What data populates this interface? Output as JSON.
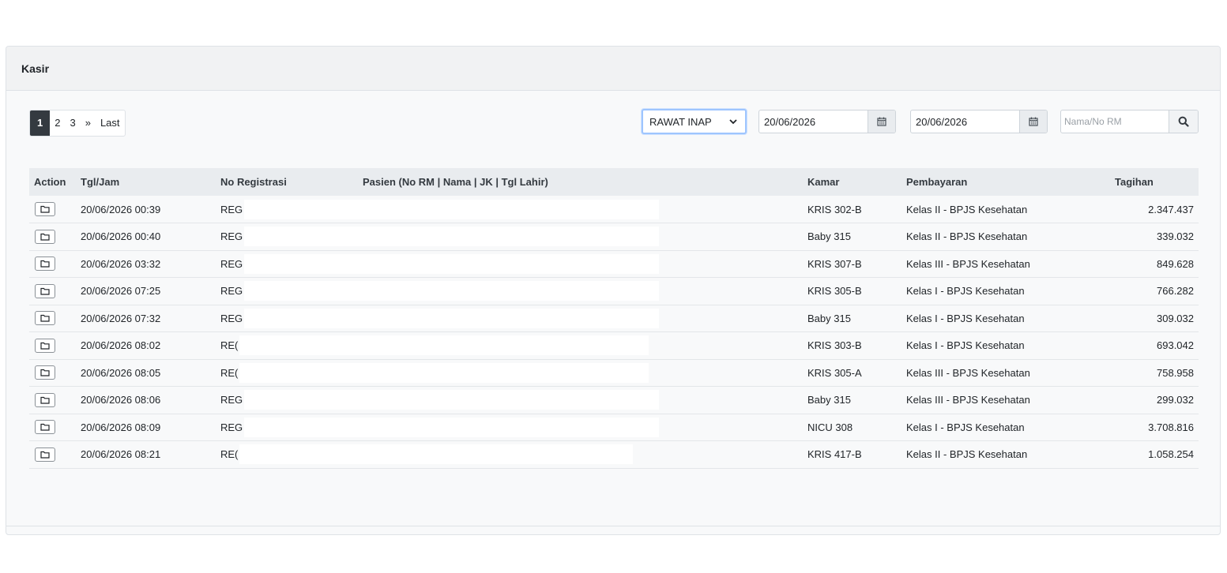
{
  "card": {
    "title": "Kasir"
  },
  "pagination": {
    "items": [
      {
        "label": "1",
        "active": true
      },
      {
        "label": "2"
      },
      {
        "label": "3"
      },
      {
        "label": "»"
      },
      {
        "label": "Last"
      }
    ]
  },
  "filters": {
    "service_type": "RAWAT INAP",
    "date_from": "20/06/2026",
    "date_to": "20/06/2026",
    "search_placeholder": "Nama/No RM"
  },
  "icons": {
    "calendar": "calendar-icon",
    "search": "search-icon",
    "folder": "folder-icon",
    "chevron": "chevron-down-icon"
  },
  "table": {
    "headers": {
      "action": "Action",
      "datetime": "Tgl/Jam",
      "reg_no": "No Registrasi",
      "patient": "Pasien (No RM | Nama | JK | Tgl Lahir)",
      "room": "Kamar",
      "payment": "Pembayaran",
      "bill": "Tagihan"
    },
    "rows": [
      {
        "datetime": "20/06/2026 00:39",
        "reg": "REG",
        "room": "KRIS 302-B",
        "payment": "Kelas II - BPJS Kesehatan",
        "bill": "2.347.437"
      },
      {
        "datetime": "20/06/2026 00:40",
        "reg": "REG",
        "room": "Baby 315",
        "payment": "Kelas II - BPJS Kesehatan",
        "bill": "339.032"
      },
      {
        "datetime": "20/06/2026 03:32",
        "reg": "REG",
        "room": "KRIS 307-B",
        "payment": "Kelas III - BPJS Kesehatan",
        "bill": "849.628"
      },
      {
        "datetime": "20/06/2026 07:25",
        "reg": "REG",
        "room": "KRIS 305-B",
        "payment": "Kelas I - BPJS Kesehatan",
        "bill": "766.282"
      },
      {
        "datetime": "20/06/2026 07:32",
        "reg": "REG",
        "room": "Baby 315",
        "payment": "Kelas I - BPJS Kesehatan",
        "bill": "309.032"
      },
      {
        "datetime": "20/06/2026 08:02",
        "reg": "RE(",
        "room": "KRIS 303-B",
        "payment": "Kelas I - BPJS Kesehatan",
        "bill": "693.042"
      },
      {
        "datetime": "20/06/2026 08:05",
        "reg": "RE(",
        "room": "KRIS 305-A",
        "payment": "Kelas III - BPJS Kesehatan",
        "bill": "758.958"
      },
      {
        "datetime": "20/06/2026 08:06",
        "reg": "REG",
        "room": "Baby 315",
        "payment": "Kelas III - BPJS Kesehatan",
        "bill": "299.032"
      },
      {
        "datetime": "20/06/2026 08:09",
        "reg": "REG",
        "room": "NICU 308",
        "payment": "Kelas I - BPJS Kesehatan",
        "bill": "3.708.816"
      },
      {
        "datetime": "20/06/2026 08:21",
        "reg": "RE(",
        "room": "KRIS 417-B",
        "payment": "Kelas II - BPJS Kesehatan",
        "bill": "1.058.254"
      }
    ]
  }
}
